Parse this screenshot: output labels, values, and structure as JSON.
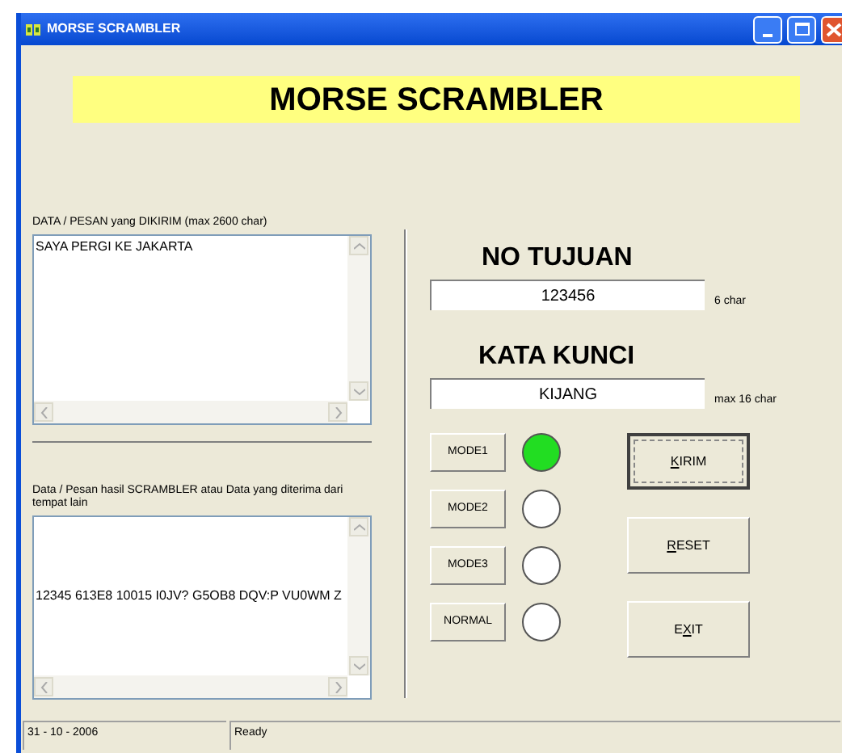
{
  "window": {
    "title": "MORSE SCRAMBLER"
  },
  "banner": "MORSE SCRAMBLER",
  "send_box": {
    "label": "DATA / PESAN yang DIKIRIM (max 2600 char)",
    "value": "SAYA PERGI KE JAKARTA"
  },
  "result_box": {
    "label": "Data / Pesan hasil SCRAMBLER atau Data yang diterima dari tempat lain",
    "value": "12345 613E8 10015 I0JV? G5OB8 DQV:P VU0WM Z"
  },
  "destination": {
    "heading": "NO TUJUAN",
    "value": "123456",
    "hint": "6 char"
  },
  "keyword": {
    "heading": "KATA KUNCI",
    "value": "KIJANG",
    "hint": "max 16 char"
  },
  "modes": [
    {
      "label": "MODE1",
      "selected": true
    },
    {
      "label": "MODE2",
      "selected": false
    },
    {
      "label": "MODE3",
      "selected": false
    },
    {
      "label": "NORMAL",
      "selected": false
    }
  ],
  "actions": [
    {
      "hotkey": "K",
      "after": "IRIM",
      "focused": true
    },
    {
      "hotkey": "R",
      "after": "ESET",
      "focused": false
    },
    {
      "before": "E",
      "hotkey": "X",
      "after": "IT",
      "focused": false
    }
  ],
  "status_bar": {
    "date": "31 - 10 - 2006",
    "message": "Ready"
  }
}
